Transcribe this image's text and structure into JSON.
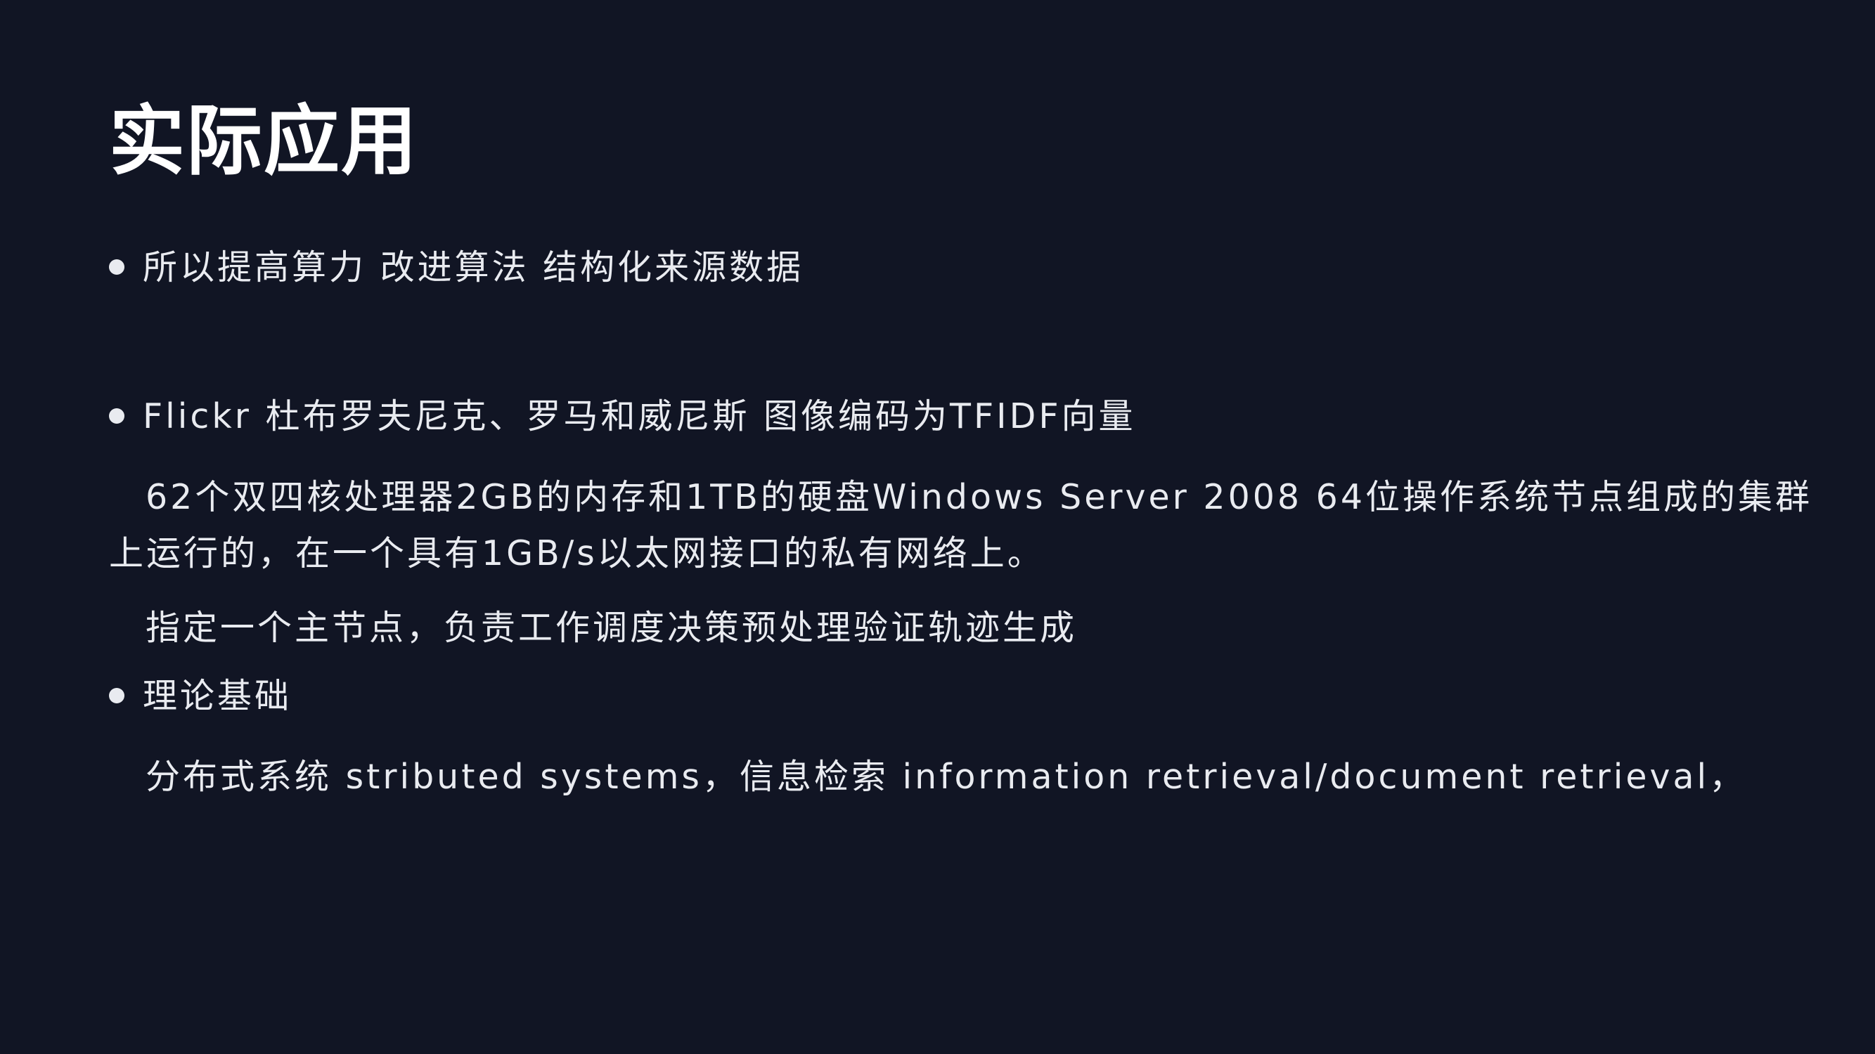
{
  "slide": {
    "title": "实际应用",
    "bullets": [
      {
        "text": "所以提高算力 改进算法 结构化来源数据"
      },
      {
        "text": "Flickr 杜布罗夫尼克、罗马和威尼斯 图像编码为TFIDF向量"
      },
      {
        "text": "理论基础"
      }
    ],
    "paragraphs": {
      "cluster_line_1": "62个双四核处理器2GB的内存和1TB的硬盘Windows Server 2008 64位操作系统节点组成的集群",
      "cluster_line_2": "上运行的，在一个具有1GB/s以太网接口的私有网络上。",
      "master_node": "指定一个主节点，负责工作调度决策预处理验证轨迹生成",
      "theory_detail": "分布式系统 stributed systems，信息检索 information retrieval/document retrieval，"
    }
  }
}
